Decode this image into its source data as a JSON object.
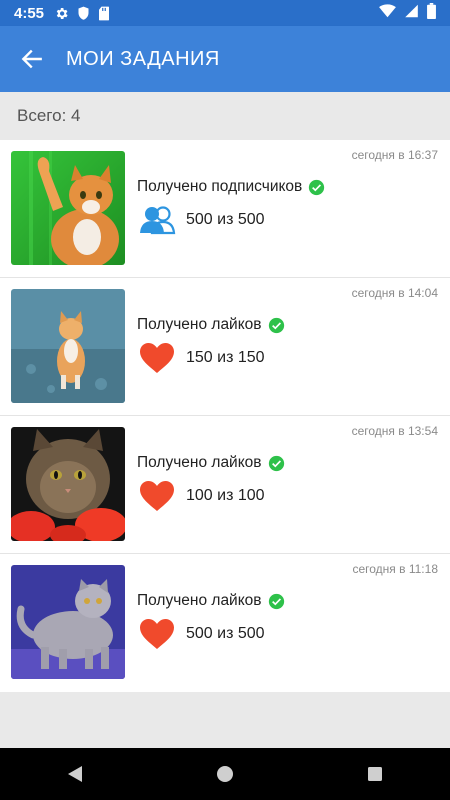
{
  "status_bar": {
    "time": "4:55",
    "icons": [
      "gear-icon",
      "shield-icon",
      "sd-card-icon",
      "wifi-icon",
      "signal-icon",
      "battery-icon"
    ]
  },
  "app_bar": {
    "title": "МОИ ЗАДАНИЯ",
    "back_icon": "arrow-back-icon",
    "color": "#3d82d9"
  },
  "summary": {
    "label": "Всего: 4"
  },
  "tasks": [
    {
      "timestamp": "сегодня в 16:37",
      "title": "Получено подписчиков",
      "type_icon": "followers-icon",
      "progress": "500 из 500",
      "thumbnail": "cat-photo-green-background"
    },
    {
      "timestamp": "сегодня в 14:04",
      "title": "Получено лайков",
      "type_icon": "heart-icon",
      "progress": "150 из 150",
      "thumbnail": "cat-photo-blue-street"
    },
    {
      "timestamp": "сегодня в 13:54",
      "title": "Получено лайков",
      "type_icon": "heart-icon",
      "progress": "100 из 100",
      "thumbnail": "cat-photo-red-flowers"
    },
    {
      "timestamp": "сегодня в 11:18",
      "title": "Получено лайков",
      "type_icon": "heart-icon",
      "progress": "500 из 500",
      "thumbnail": "cat-photo-purple-background"
    }
  ],
  "colors": {
    "status_bar": "#2a6fc9",
    "check": "#2ec14a",
    "heart": "#f04a2c",
    "followers": "#2d95e0"
  },
  "nav_bar": {
    "icons": [
      "back-triangle-icon",
      "home-circle-icon",
      "recents-square-icon"
    ]
  }
}
